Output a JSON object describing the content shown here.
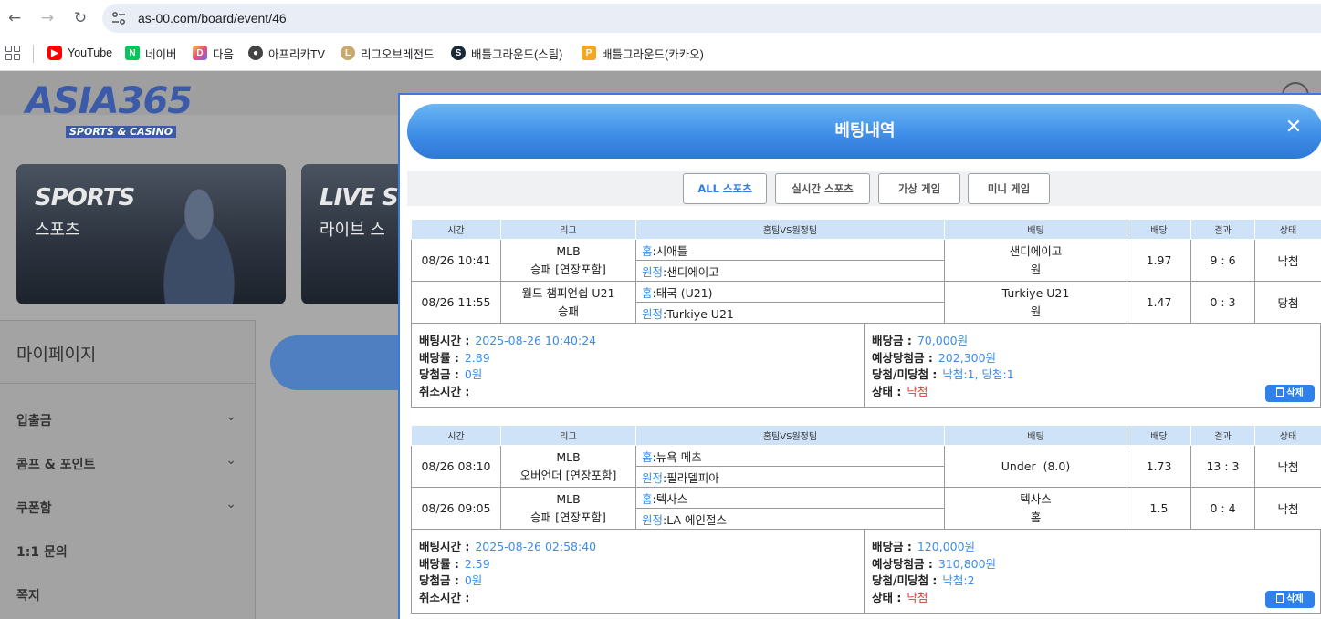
{
  "browser": {
    "url": "as-00.com/board/event/46",
    "bookmarks": [
      {
        "label": "YouTube",
        "icon": "youtube-icon",
        "color": "#ff0000"
      },
      {
        "label": "네이버",
        "icon": "naver-icon",
        "color": "#03c75a"
      },
      {
        "label": "다음",
        "icon": "daum-icon",
        "color": "#6d6cf5"
      },
      {
        "label": "아프리카TV",
        "icon": "afreecatv-icon",
        "color": "#444444"
      },
      {
        "label": "리그오브레전드",
        "icon": "lol-icon",
        "color": "#c8aa6e"
      },
      {
        "label": "배틀그라운드(스팀)",
        "icon": "steam-icon",
        "color": "#1b2838"
      },
      {
        "label": "배틀그라운드(카카오)",
        "icon": "pubg-kakao-icon",
        "color": "#f5a623"
      }
    ]
  },
  "site": {
    "logo_main": "ASIA365",
    "logo_sub": "SPORTS & CASINO",
    "banners": [
      {
        "en": "SPORTS",
        "ko": "스포츠"
      },
      {
        "en": "LIVE SP",
        "ko": "라이브 스"
      }
    ],
    "mypage": {
      "title": "마이페이지",
      "items": [
        {
          "label": "입출금",
          "has_chevron": true
        },
        {
          "label": "콤프 & 포인트",
          "has_chevron": true
        },
        {
          "label": "쿠폰함",
          "has_chevron": true
        },
        {
          "label": "1:1 문의",
          "has_chevron": false
        },
        {
          "label": "쪽지",
          "has_chevron": false
        }
      ]
    }
  },
  "modal": {
    "title": "베팅내역",
    "close": "✕",
    "filters": [
      {
        "label": "ALL 스포츠",
        "active": true
      },
      {
        "label": "실시간 스포츠",
        "active": false
      },
      {
        "label": "가상 게임",
        "active": false
      },
      {
        "label": "미니 게임",
        "active": false
      }
    ],
    "headers": [
      "시간",
      "리그",
      "홈팀VS원정팀",
      "배팅",
      "배당",
      "결과",
      "상태"
    ],
    "home_label": "홈",
    "away_label": "원정",
    "summary_labels": {
      "bet_time": "배팅시간 :",
      "odds": "배당률 :",
      "win_amount": "당첨금 :",
      "cancel_time": "취소시간 :",
      "bet_amount": "배당금 :",
      "expected": "예상당첨금 :",
      "win_lose": "당첨/미당첨 :",
      "status": "상태 :"
    },
    "delete_label": "삭제",
    "bets": [
      {
        "games": [
          {
            "time": "08/26 10:41",
            "league": "MLB",
            "market": "승패 [연장포함]",
            "home": ":시애틀",
            "away": ":샌디에이고",
            "pick": "샌디에이고",
            "pick_side": "원",
            "odds": "1.97",
            "result": "9 : 6",
            "status": "낙첨"
          },
          {
            "time": "08/26 11:55",
            "league": "월드 챔피언쉽 U21",
            "market": "승패",
            "home": ":태국 (U21)",
            "away": ":Turkiye U21",
            "pick": "Turkiye U21",
            "pick_side": "원",
            "odds": "1.47",
            "result": "0 : 3",
            "status": "당첨"
          }
        ],
        "summary": {
          "bet_time": "2025-08-26 10:40:24",
          "odds": "2.89",
          "win_amount": "0원",
          "cancel_time": "",
          "bet_amount": "70,000원",
          "expected": "202,300원",
          "win_lose": "낙첨:1, 당첨:1",
          "status": "낙첨"
        }
      },
      {
        "games": [
          {
            "time": "08/26 08:10",
            "league": "MLB",
            "market": "오버언더 [연장포함]",
            "home": ":뉴욕 메츠",
            "away": ":필라델피아",
            "pick": "Under  (8.0)",
            "pick_side": "",
            "odds": "1.73",
            "result": "13 : 3",
            "status": "낙첨"
          },
          {
            "time": "08/26 09:05",
            "league": "MLB",
            "market": "승패 [연장포함]",
            "home": ":텍사스",
            "away": ":LA 에인절스",
            "pick": "텍사스",
            "pick_side": "홈",
            "odds": "1.5",
            "result": "0 : 4",
            "status": "낙첨"
          }
        ],
        "summary": {
          "bet_time": "2025-08-26 02:58:40",
          "odds": "2.59",
          "win_amount": "0원",
          "cancel_time": "",
          "bet_amount": "120,000원",
          "expected": "310,800원",
          "win_lose": "낙첨:2",
          "status": "낙첨"
        }
      }
    ]
  }
}
